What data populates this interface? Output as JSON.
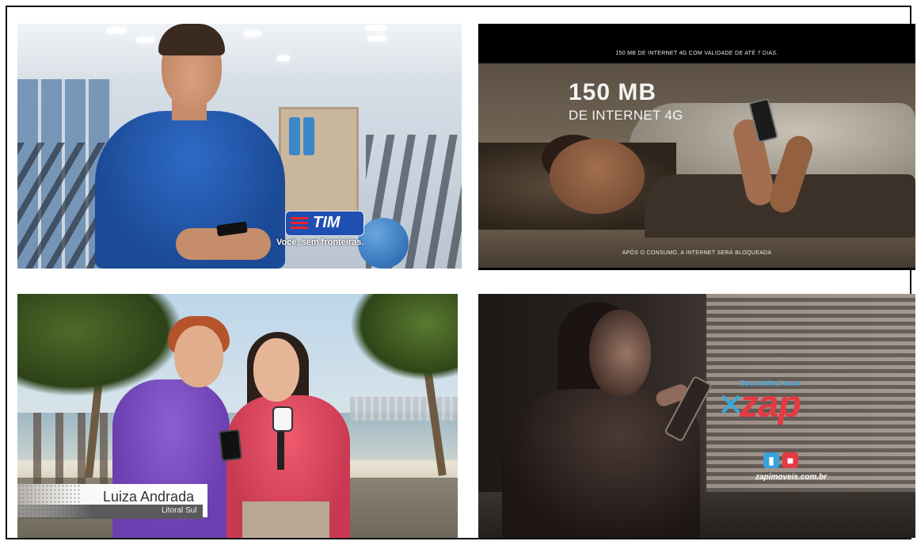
{
  "panels": {
    "tim": {
      "brand": "TIM",
      "slogan": "Você, sem fronteiras."
    },
    "internet": {
      "top_caption": "150 MB DE INTERNET 4G COM VALIDADE DE ATÉ 7 DIAS.",
      "headline": "150 MB",
      "subheadline": "DE INTERNET 4G",
      "bottom_caption": "APÓS O CONSUMO, A INTERNET SERÁ BLOQUEADA"
    },
    "reporter": {
      "name": "Luiza Andrada",
      "location": "Litoral Sul"
    },
    "zap": {
      "tagline": "Seu imóvel num",
      "logo": "zap",
      "url": "zapimoveis.com.br"
    }
  },
  "colors": {
    "tim_blue": "#1f4fb0",
    "zap_red": "#e43a43",
    "zap_blue": "#39a9dc"
  }
}
